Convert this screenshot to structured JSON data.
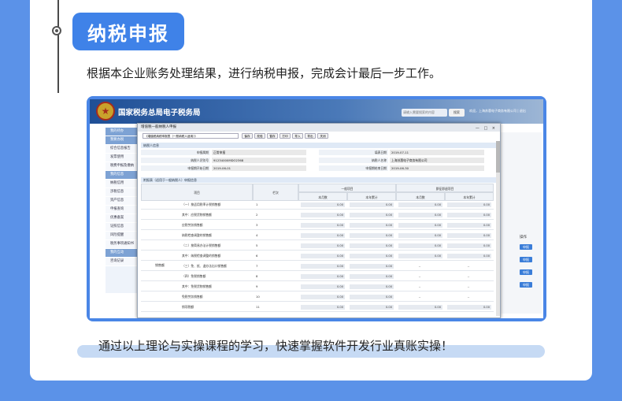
{
  "section": {
    "title": "纳税申报",
    "description": "根据本企业账务处理结果，进行纳税申报，完成会计最后一步工作。",
    "footer": "通过以上理论与实操课程的学习，快速掌握软件开发行业真账实操！"
  },
  "app": {
    "title": "国家税务总局电子税务局",
    "search_placeholder": "请输入需要搜索的内容",
    "search_btn": "搜索",
    "user": "欢迎，上海苏蕙电子商务有限公司 | 退出",
    "sidebar": [
      {
        "label": "我的待办",
        "kind": "head"
      },
      {
        "label": "我要办税",
        "kind": "head"
      },
      {
        "label": "综合信息报告",
        "kind": "sub"
      },
      {
        "label": "发票使用",
        "kind": "sub"
      },
      {
        "label": "税费申报及缴纳",
        "kind": "sub"
      },
      {
        "label": "我的信息",
        "kind": "head"
      },
      {
        "label": "纳税信用",
        "kind": "sub"
      },
      {
        "label": "涉税信息",
        "kind": "sub"
      },
      {
        "label": "资产信息",
        "kind": "sub"
      },
      {
        "label": "申报查询",
        "kind": "sub"
      },
      {
        "label": "优惠备案",
        "kind": "sub"
      },
      {
        "label": "证照信息",
        "kind": "sub"
      },
      {
        "label": "风险提醒",
        "kind": "sub"
      },
      {
        "label": "税务事项通知书",
        "kind": "sub"
      },
      {
        "label": "我的互动",
        "kind": "head"
      },
      {
        "label": "咨询记录",
        "kind": "sub"
      }
    ],
    "right_label": "操作",
    "right_buttons": [
      "申报",
      "申报",
      "申报",
      "申报"
    ]
  },
  "modal": {
    "title": "增值税一般纳税人申报",
    "controls": "— □ ×",
    "select": "《增值税纳税申报表（一般纳税人适用）》",
    "buttons": [
      "保存",
      "校验",
      "暂存",
      "打印",
      "导入",
      "导出",
      "关闭"
    ],
    "sec1": "纳税人信息",
    "info": [
      [
        "申报属期",
        "正常申报",
        "填表日期",
        "2019-07-11"
      ],
      [
        "纳税人识别号",
        "91234000MDO2368",
        "纳税人名称",
        "上海苏蕙电子商务有限公司"
      ],
      [
        "申报期开始日期",
        "2019-06-01",
        "申报期结束日期",
        "2019-06-30"
      ]
    ],
    "sec2": "附报表（适用于一般纳税人）申报信息",
    "grid_headers": {
      "item": "项目",
      "col": "栏次",
      "g1": "一般项目",
      "g2": "即征即退项目",
      "m": "本月数",
      "y": "本年累计"
    },
    "side_label": "销售额",
    "rows": [
      {
        "name": "（一）按适用税率计税销售额",
        "no": "1",
        "vals": [
          "0.00",
          "0.00",
          "0.00",
          "0.00"
        ]
      },
      {
        "name": "其中：应税货物销售额",
        "no": "2",
        "vals": [
          "0.00",
          "0.00",
          "0.00",
          "0.00"
        ]
      },
      {
        "name": "应税劳务销售额",
        "no": "3",
        "vals": [
          "0.00",
          "0.00",
          "0.00",
          "0.00"
        ]
      },
      {
        "name": "纳税检查调整的销售额",
        "no": "4",
        "vals": [
          "0.00",
          "0.00",
          "0.00",
          "0.00"
        ]
      },
      {
        "name": "（二）按简易办法计税销售额",
        "no": "5",
        "vals": [
          "0.00",
          "0.00",
          "0.00",
          "0.00"
        ]
      },
      {
        "name": "其中：纳税检查调整的销售额",
        "no": "6",
        "vals": [
          "0.00",
          "0.00",
          "0.00",
          "0.00"
        ]
      },
      {
        "name": "（三）免、抵、退办法出口销售额",
        "no": "7",
        "vals": [
          "0.00",
          "0.00",
          "--",
          "--"
        ]
      },
      {
        "name": "（四）免税销售额",
        "no": "8",
        "vals": [
          "0.00",
          "0.00",
          "--",
          "--"
        ]
      },
      {
        "name": "其中：免税货物销售额",
        "no": "9",
        "vals": [
          "0.00",
          "0.00",
          "--",
          "--"
        ]
      },
      {
        "name": "免税劳务销售额",
        "no": "10",
        "vals": [
          "0.00",
          "0.00",
          "--",
          "--"
        ]
      },
      {
        "name": "销项税额",
        "no": "11",
        "vals": [
          "0.00",
          "0.00",
          "0.00",
          "0.00"
        ]
      }
    ]
  }
}
